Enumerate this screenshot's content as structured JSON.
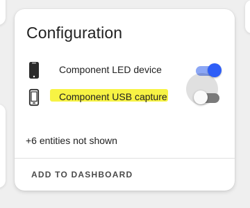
{
  "card": {
    "title": "Configuration",
    "entities": [
      {
        "name": "Component LED device",
        "icon": "cellphone-icon",
        "state": "on",
        "highlighted": false
      },
      {
        "name": "Component USB capture",
        "icon": "cellphone-outline-icon",
        "state": "off",
        "highlighted": true
      }
    ],
    "more_text": "+6 entities not shown",
    "action_label": "ADD TO DASHBOARD"
  },
  "colors": {
    "toggle_on_knob": "#2e5ef7",
    "toggle_on_track": "#8ca7f5",
    "toggle_off_track": "#7a7a7a",
    "highlight": "#f7f23a"
  }
}
